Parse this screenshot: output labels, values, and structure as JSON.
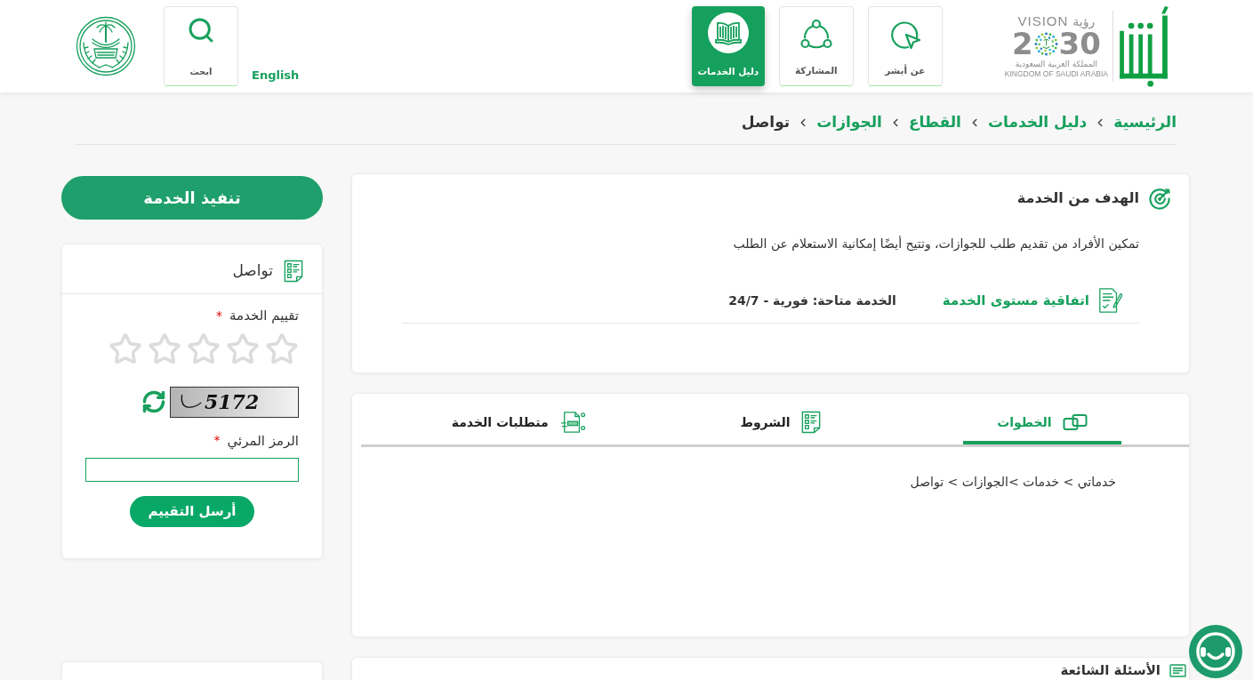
{
  "header": {
    "vision_logo": {
      "word_en": "VISION",
      "word_ar": "رؤية",
      "year_start": "2",
      "year_end": "30",
      "country_ar": "المملكة العربية السعودية",
      "country_en": "KINGDOM OF SAUDI ARABIA"
    },
    "nav": [
      {
        "label": "عن أبشر",
        "selected": false
      },
      {
        "label": "المشاركة",
        "selected": false
      },
      {
        "label": "دليل الخدمات",
        "selected": true
      }
    ],
    "language_link": "English",
    "search_button": "ابحث"
  },
  "breadcrumb": [
    {
      "label": "الرئيسية",
      "current": false
    },
    {
      "label": "دليل الخدمات",
      "current": false
    },
    {
      "label": "القطاع",
      "current": false
    },
    {
      "label": "الجوازات",
      "current": false
    },
    {
      "label": "تواصل",
      "current": true
    }
  ],
  "service_goal": {
    "title": "الهدف من الخدمة",
    "description": "تمكين الأفراد من تقديم طلب للجوازات، وتتيح أيضًا إمكانية الاستعلام عن الطلب",
    "sla_link": "اتفاقية مستوى الخدمة",
    "availability": "الخدمة متاحة: فورية - 24/7"
  },
  "service_tabs": {
    "tabs": [
      {
        "label": "الخطوات",
        "selected": true
      },
      {
        "label": "الشروط",
        "selected": false
      },
      {
        "label": "متطلبات الخدمة",
        "selected": false
      }
    ],
    "content": "خدماتي > خدمات >الجوازات > تواصل"
  },
  "faq": {
    "title": "الأسئلة الشائعة"
  },
  "sidebar": {
    "execute_button": "تنفيذ الخدمة",
    "rating_card": {
      "title": "تواصل",
      "rating_label": "تقييم الخدمة",
      "rating_required_mark": "*",
      "stars": 0,
      "captcha_code": "5172",
      "captcha_label": "الرمز المرئي",
      "captcha_required_mark": "*",
      "submit_button": "أرسل التقييم"
    }
  }
}
